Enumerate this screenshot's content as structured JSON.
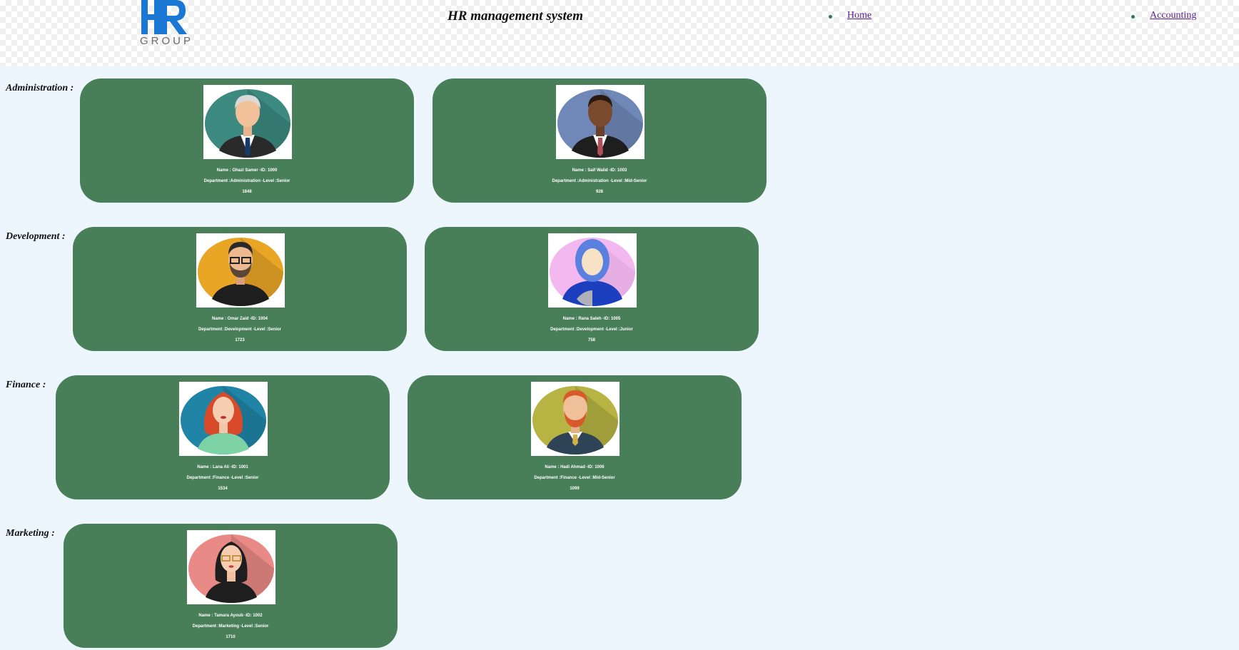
{
  "header": {
    "logo_text": "HR",
    "logo_sub": "GROUP",
    "title": "HR management system",
    "nav": [
      {
        "label": "Home"
      },
      {
        "label": "Accounting"
      }
    ]
  },
  "colors": {
    "card_bg": "#487e58",
    "page_bg": "#eef6fd",
    "logo_blue": "#1a77d4",
    "link": "#5a1f8a"
  },
  "departments": [
    {
      "label": "Administration :",
      "employees": [
        {
          "avatar": "old-man-avatar-icon",
          "name_line": "Name : Ghazi Samer -ID: 1000",
          "dept_line": "Department :Administration -Level :Senior",
          "number": "1848"
        },
        {
          "avatar": "businessman-avatar-icon",
          "name_line": "Name : Saif Walid -ID: 1003",
          "dept_line": "Department :Administration -Level :Mid-Senior",
          "number": "928"
        }
      ]
    },
    {
      "label": "Development :",
      "employees": [
        {
          "avatar": "bearded-man-glasses-avatar-icon",
          "name_line": "Name : Omar Zaid -ID: 1004",
          "dept_line": "Department :Development -Level :Senior",
          "number": "1723"
        },
        {
          "avatar": "woman-hijab-avatar-icon",
          "name_line": "Name : Rana Saleh -ID: 1005",
          "dept_line": "Department :Development -Level :Junior",
          "number": "758"
        }
      ]
    },
    {
      "label": "Finance :",
      "employees": [
        {
          "avatar": "red-hair-woman-avatar-icon",
          "name_line": "Name : Lana Ali -ID: 1001",
          "dept_line": "Department :Finance -Level :Senior",
          "number": "1534"
        },
        {
          "avatar": "ginger-beard-man-avatar-icon",
          "name_line": "Name : Hadi Ahmad -ID: 1006",
          "dept_line": "Department :Finance -Level :Mid-Senior",
          "number": "1099"
        }
      ]
    },
    {
      "label": "Marketing :",
      "employees": [
        {
          "avatar": "woman-glasses-avatar-icon",
          "name_line": "Name : Tamara Ayoub -ID: 1002",
          "dept_line": "Department :Marketing -Level :Senior",
          "number": "1710"
        }
      ]
    }
  ]
}
